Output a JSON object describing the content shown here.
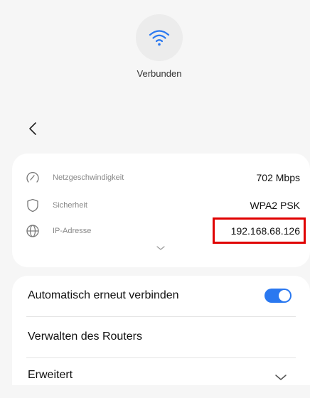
{
  "status": {
    "label": "Verbunden",
    "icon": "wifi-icon"
  },
  "nav": {
    "back_icon": "back-chevron-icon"
  },
  "info": {
    "rows": [
      {
        "icon": "speed-gauge-icon",
        "label": "Netzgeschwindigkeit",
        "value": "702 Mbps"
      },
      {
        "icon": "shield-icon",
        "label": "Sicherheit",
        "value": "WPA2 PSK"
      },
      {
        "icon": "globe-icon",
        "label": "IP-Adresse",
        "value": "192.168.68.126"
      }
    ],
    "expand_icon": "chevron-down-icon"
  },
  "settings": {
    "auto_reconnect": {
      "label": "Automatisch erneut verbinden",
      "enabled": true
    },
    "manage_router": {
      "label": "Verwalten des Routers"
    },
    "advanced": {
      "label": "Erweitert",
      "icon": "chevron-down-icon"
    }
  },
  "colors": {
    "accent": "#2a78f0",
    "highlight": "#e00000",
    "background": "#f6f6f6",
    "card": "#ffffff"
  }
}
